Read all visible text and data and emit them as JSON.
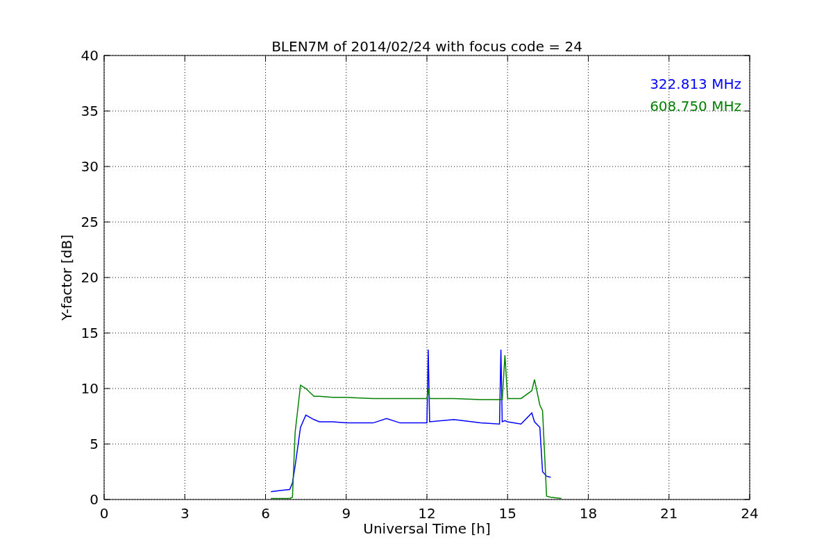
{
  "figure": {
    "chart_data": {
      "type": "line",
      "title": "BLEN7M of 2014/02/24 with focus code = 24",
      "xlabel": "Universal Time [h]",
      "ylabel": "Y-factor [dB]",
      "xlim": [
        0,
        24
      ],
      "ylim": [
        0,
        40
      ],
      "xticks": [
        0,
        3,
        6,
        9,
        12,
        15,
        18,
        21,
        24
      ],
      "yticks": [
        0,
        5,
        10,
        15,
        20,
        25,
        30,
        35,
        40
      ],
      "grid": true,
      "x": [
        6.2,
        6.5,
        6.9,
        7.0,
        7.1,
        7.3,
        7.5,
        7.8,
        8.0,
        8.5,
        9.0,
        10.0,
        10.5,
        11.0,
        12.0,
        12.05,
        12.1,
        13.0,
        14.0,
        14.7,
        14.75,
        14.8,
        14.9,
        15.0,
        15.5,
        15.9,
        16.0,
        16.2,
        16.3,
        16.45,
        16.6,
        17.0
      ],
      "series": [
        {
          "name": "322.813 MHz",
          "color": "#0000ff",
          "values": [
            0.7,
            0.8,
            0.9,
            1.5,
            3.0,
            6.5,
            7.6,
            7.2,
            7.0,
            7.0,
            6.9,
            6.9,
            7.3,
            6.9,
            6.9,
            13.5,
            7.0,
            7.2,
            6.9,
            6.8,
            13.5,
            7.0,
            7.1,
            7.0,
            6.8,
            7.8,
            7.0,
            6.5,
            2.5,
            2.1,
            2.0,
            null
          ]
        },
        {
          "name": "608.750 MHz",
          "color": "#008000",
          "values": [
            0.1,
            0.1,
            0.1,
            0.2,
            6.0,
            10.3,
            10.0,
            9.3,
            9.3,
            9.2,
            9.2,
            9.1,
            9.1,
            9.1,
            9.1,
            10.0,
            9.1,
            9.1,
            9.0,
            9.0,
            9.0,
            9.0,
            13.0,
            9.1,
            9.1,
            9.8,
            10.8,
            8.5,
            8.0,
            0.3,
            0.2,
            0.1
          ]
        }
      ]
    }
  }
}
